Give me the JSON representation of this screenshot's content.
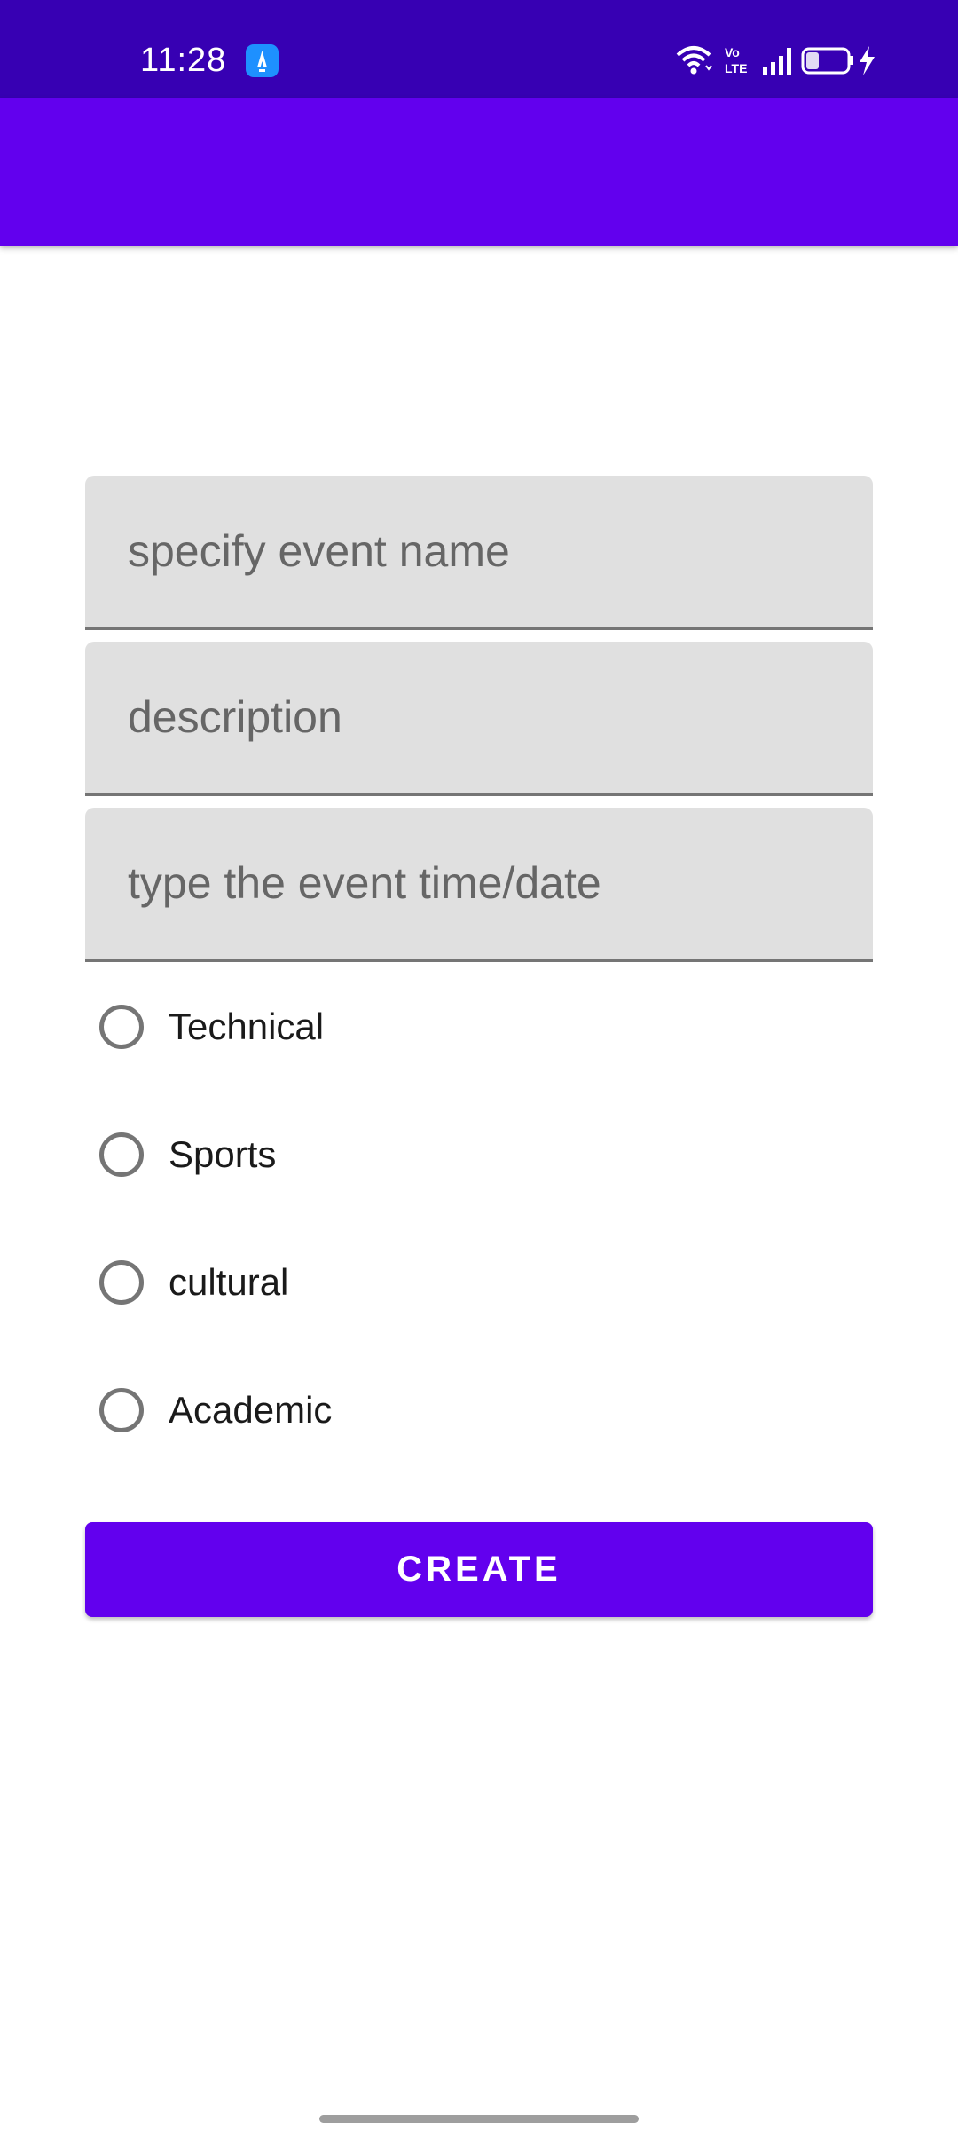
{
  "status_bar": {
    "time": "11:28",
    "battery_level": "27",
    "icons": [
      "app-notification-icon",
      "wifi-icon",
      "volte-icon",
      "signal-icon",
      "battery-icon",
      "charging-icon"
    ]
  },
  "app_bar": {},
  "form": {
    "event_name_placeholder": "specify event name",
    "description_placeholder": "description",
    "datetime_placeholder": "type the event time/date",
    "categories": [
      {
        "label": "Technical",
        "selected": false
      },
      {
        "label": "Sports",
        "selected": false
      },
      {
        "label": "cultural",
        "selected": false
      },
      {
        "label": "Academic",
        "selected": false
      }
    ],
    "create_label": "CREATE"
  },
  "colors": {
    "status_bar": "#3700b3",
    "primary": "#6200ee",
    "field_background": "#e0e0e0"
  }
}
